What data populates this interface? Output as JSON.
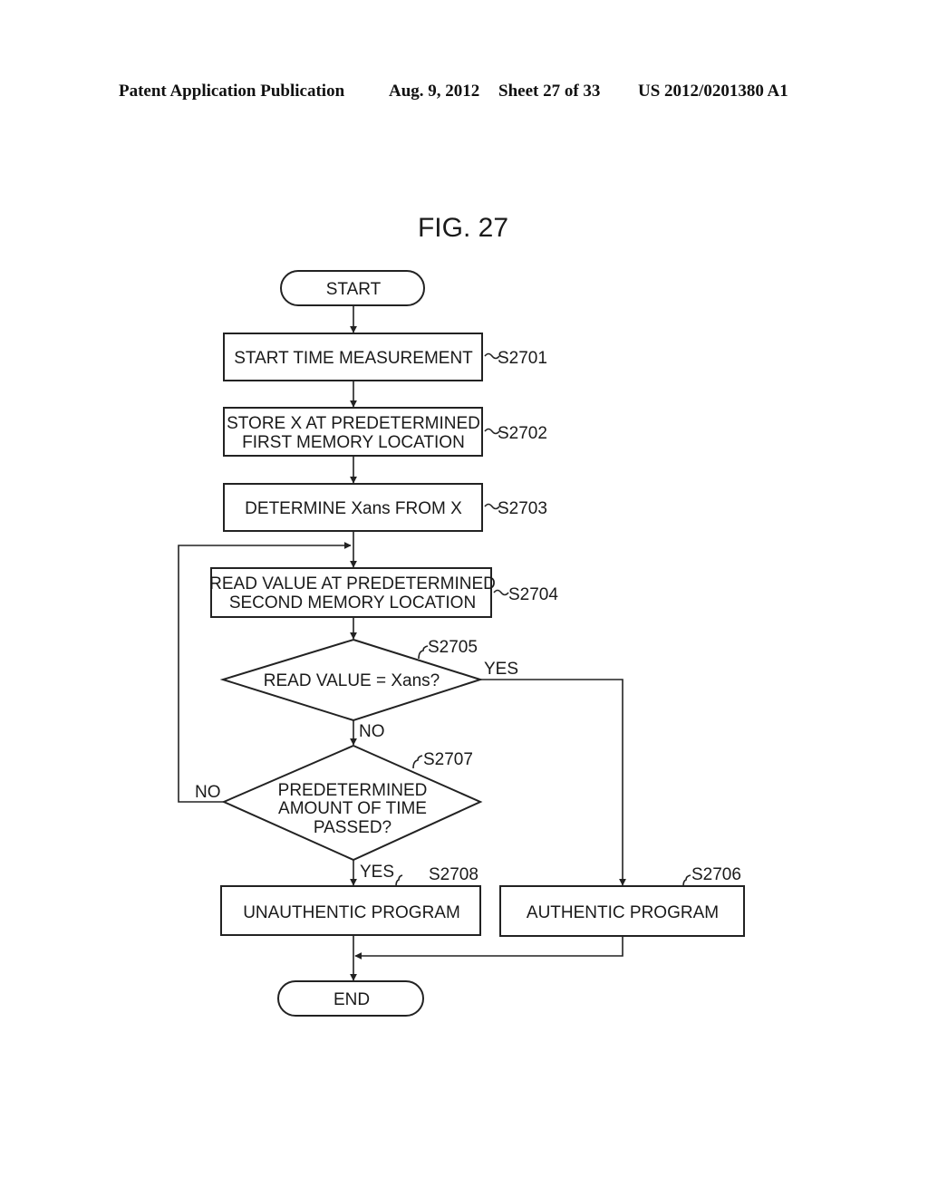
{
  "header": {
    "publication": "Patent Application Publication",
    "date": "Aug. 9, 2012",
    "sheet": "Sheet 27 of 33",
    "number": "US 2012/0201380 A1"
  },
  "figure": {
    "title": "FIG. 27",
    "nodes": {
      "start": {
        "type": "terminal",
        "text": [
          "START"
        ]
      },
      "s2701": {
        "type": "process",
        "ref": "S2701",
        "text": [
          "START TIME MEASUREMENT"
        ]
      },
      "s2702": {
        "type": "process",
        "ref": "S2702",
        "text": [
          "STORE X AT PREDETERMINED",
          "FIRST MEMORY LOCATION"
        ]
      },
      "s2703": {
        "type": "process",
        "ref": "S2703",
        "text": [
          "DETERMINE Xans FROM X"
        ]
      },
      "s2704": {
        "type": "process",
        "ref": "S2704",
        "text": [
          "READ VALUE AT PREDETERMINED",
          "SECOND MEMORY LOCATION"
        ]
      },
      "s2705": {
        "type": "decision",
        "ref": "S2705",
        "text": [
          "READ VALUE = Xans?"
        ]
      },
      "s2707": {
        "type": "decision",
        "ref": "S2707",
        "text": [
          "PREDETERMINED",
          "AMOUNT OF TIME",
          "PASSED?"
        ]
      },
      "s2708": {
        "type": "process",
        "ref": "S2708",
        "text": [
          "UNAUTHENTIC PROGRAM"
        ]
      },
      "s2706": {
        "type": "process",
        "ref": "S2706",
        "text": [
          "AUTHENTIC PROGRAM"
        ]
      },
      "end": {
        "type": "terminal",
        "text": [
          "END"
        ]
      }
    },
    "edges": [
      {
        "from": "start",
        "to": "s2701",
        "label": ""
      },
      {
        "from": "s2701",
        "to": "s2702",
        "label": ""
      },
      {
        "from": "s2702",
        "to": "s2703",
        "label": ""
      },
      {
        "from": "s2703",
        "to": "s2704",
        "label": ""
      },
      {
        "from": "s2704",
        "to": "s2705",
        "label": ""
      },
      {
        "from": "s2705",
        "to": "s2706",
        "label": "YES"
      },
      {
        "from": "s2705",
        "to": "s2707",
        "label": "NO"
      },
      {
        "from": "s2707",
        "to": "s2704",
        "label": "NO"
      },
      {
        "from": "s2707",
        "to": "s2708",
        "label": "YES"
      },
      {
        "from": "s2708",
        "to": "end",
        "label": ""
      },
      {
        "from": "s2706",
        "to": "end",
        "label": ""
      }
    ]
  }
}
